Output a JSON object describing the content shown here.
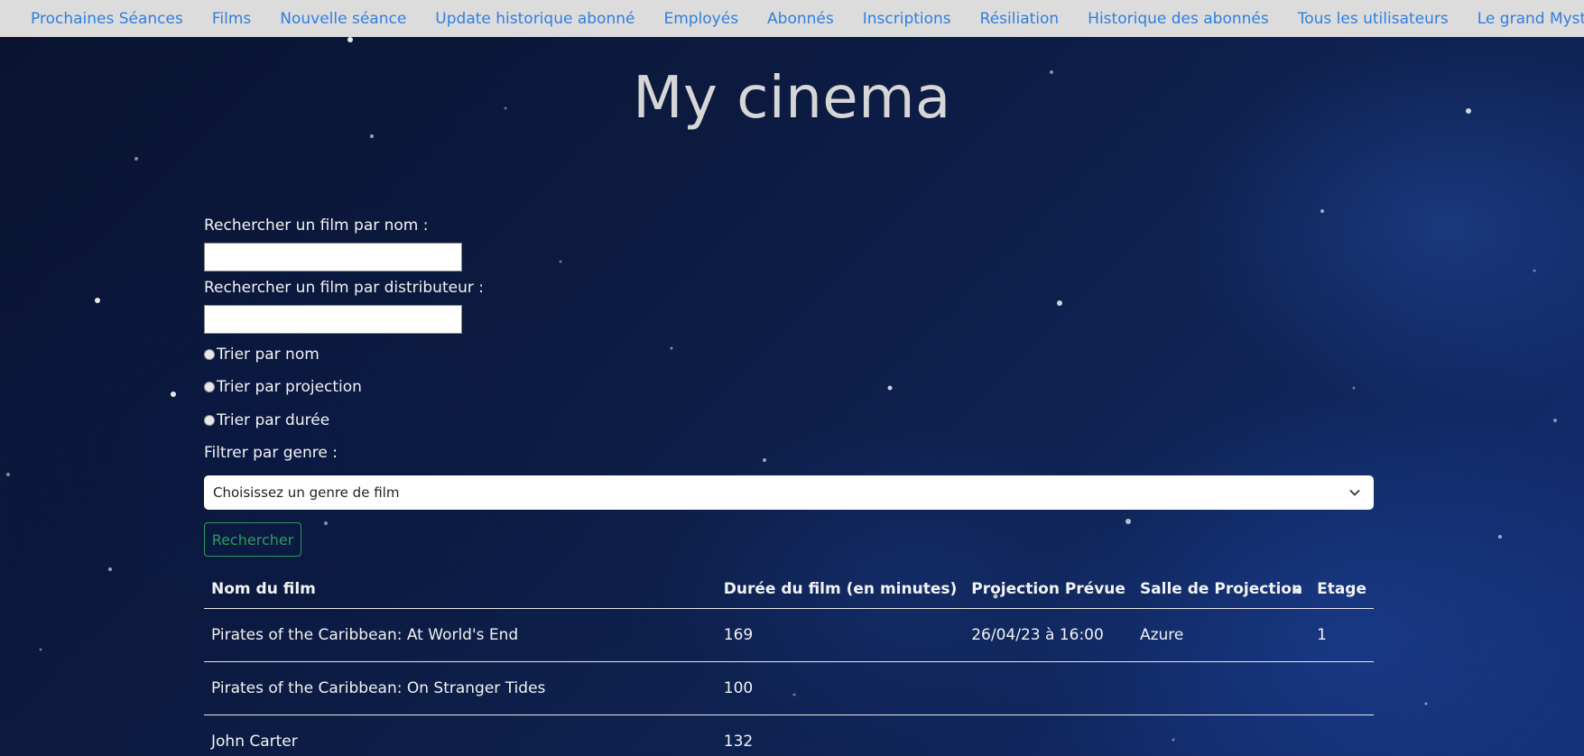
{
  "nav": {
    "items": [
      {
        "label": "Prochaines Séances"
      },
      {
        "label": "Films"
      },
      {
        "label": "Nouvelle séance"
      },
      {
        "label": "Update historique abonné"
      },
      {
        "label": "Employés"
      },
      {
        "label": "Abonnés"
      },
      {
        "label": "Inscriptions"
      },
      {
        "label": "Résiliation"
      },
      {
        "label": "Historique des abonnés"
      },
      {
        "label": "Tous les utilisateurs"
      },
      {
        "label": "Le grand Mystère"
      }
    ]
  },
  "page": {
    "title": "My cinema"
  },
  "search": {
    "name_label": "Rechercher un film par nom :",
    "name_value": "",
    "distributor_label": "Rechercher un film par distributeur :",
    "distributor_value": ""
  },
  "sort": {
    "options": [
      {
        "label": "Trier par nom"
      },
      {
        "label": "Trier par projection"
      },
      {
        "label": "Trier par durée"
      }
    ]
  },
  "genre_filter": {
    "label": "Filtrer par genre :",
    "selected": "Choisissez un genre de film"
  },
  "submit_label": "Rechercher",
  "table": {
    "headers": [
      "Nom du film",
      "Durée du film (en minutes)",
      "Projection Prévue",
      "Salle de Projection",
      "Etage"
    ],
    "rows": [
      [
        "Pirates of the Caribbean: At World's End",
        "169",
        "26/04/23 à 16:00",
        "Azure",
        "1"
      ],
      [
        "Pirates of the Caribbean: On Stranger Tides",
        "100",
        "",
        "",
        ""
      ],
      [
        "John Carter",
        "132",
        "",
        "",
        ""
      ]
    ]
  },
  "colors": {
    "nav_background": "#dcdcdc",
    "nav_link": "#2f7fe0",
    "button_accent": "#2e9c5c",
    "title_text": "#d6d6d6"
  }
}
